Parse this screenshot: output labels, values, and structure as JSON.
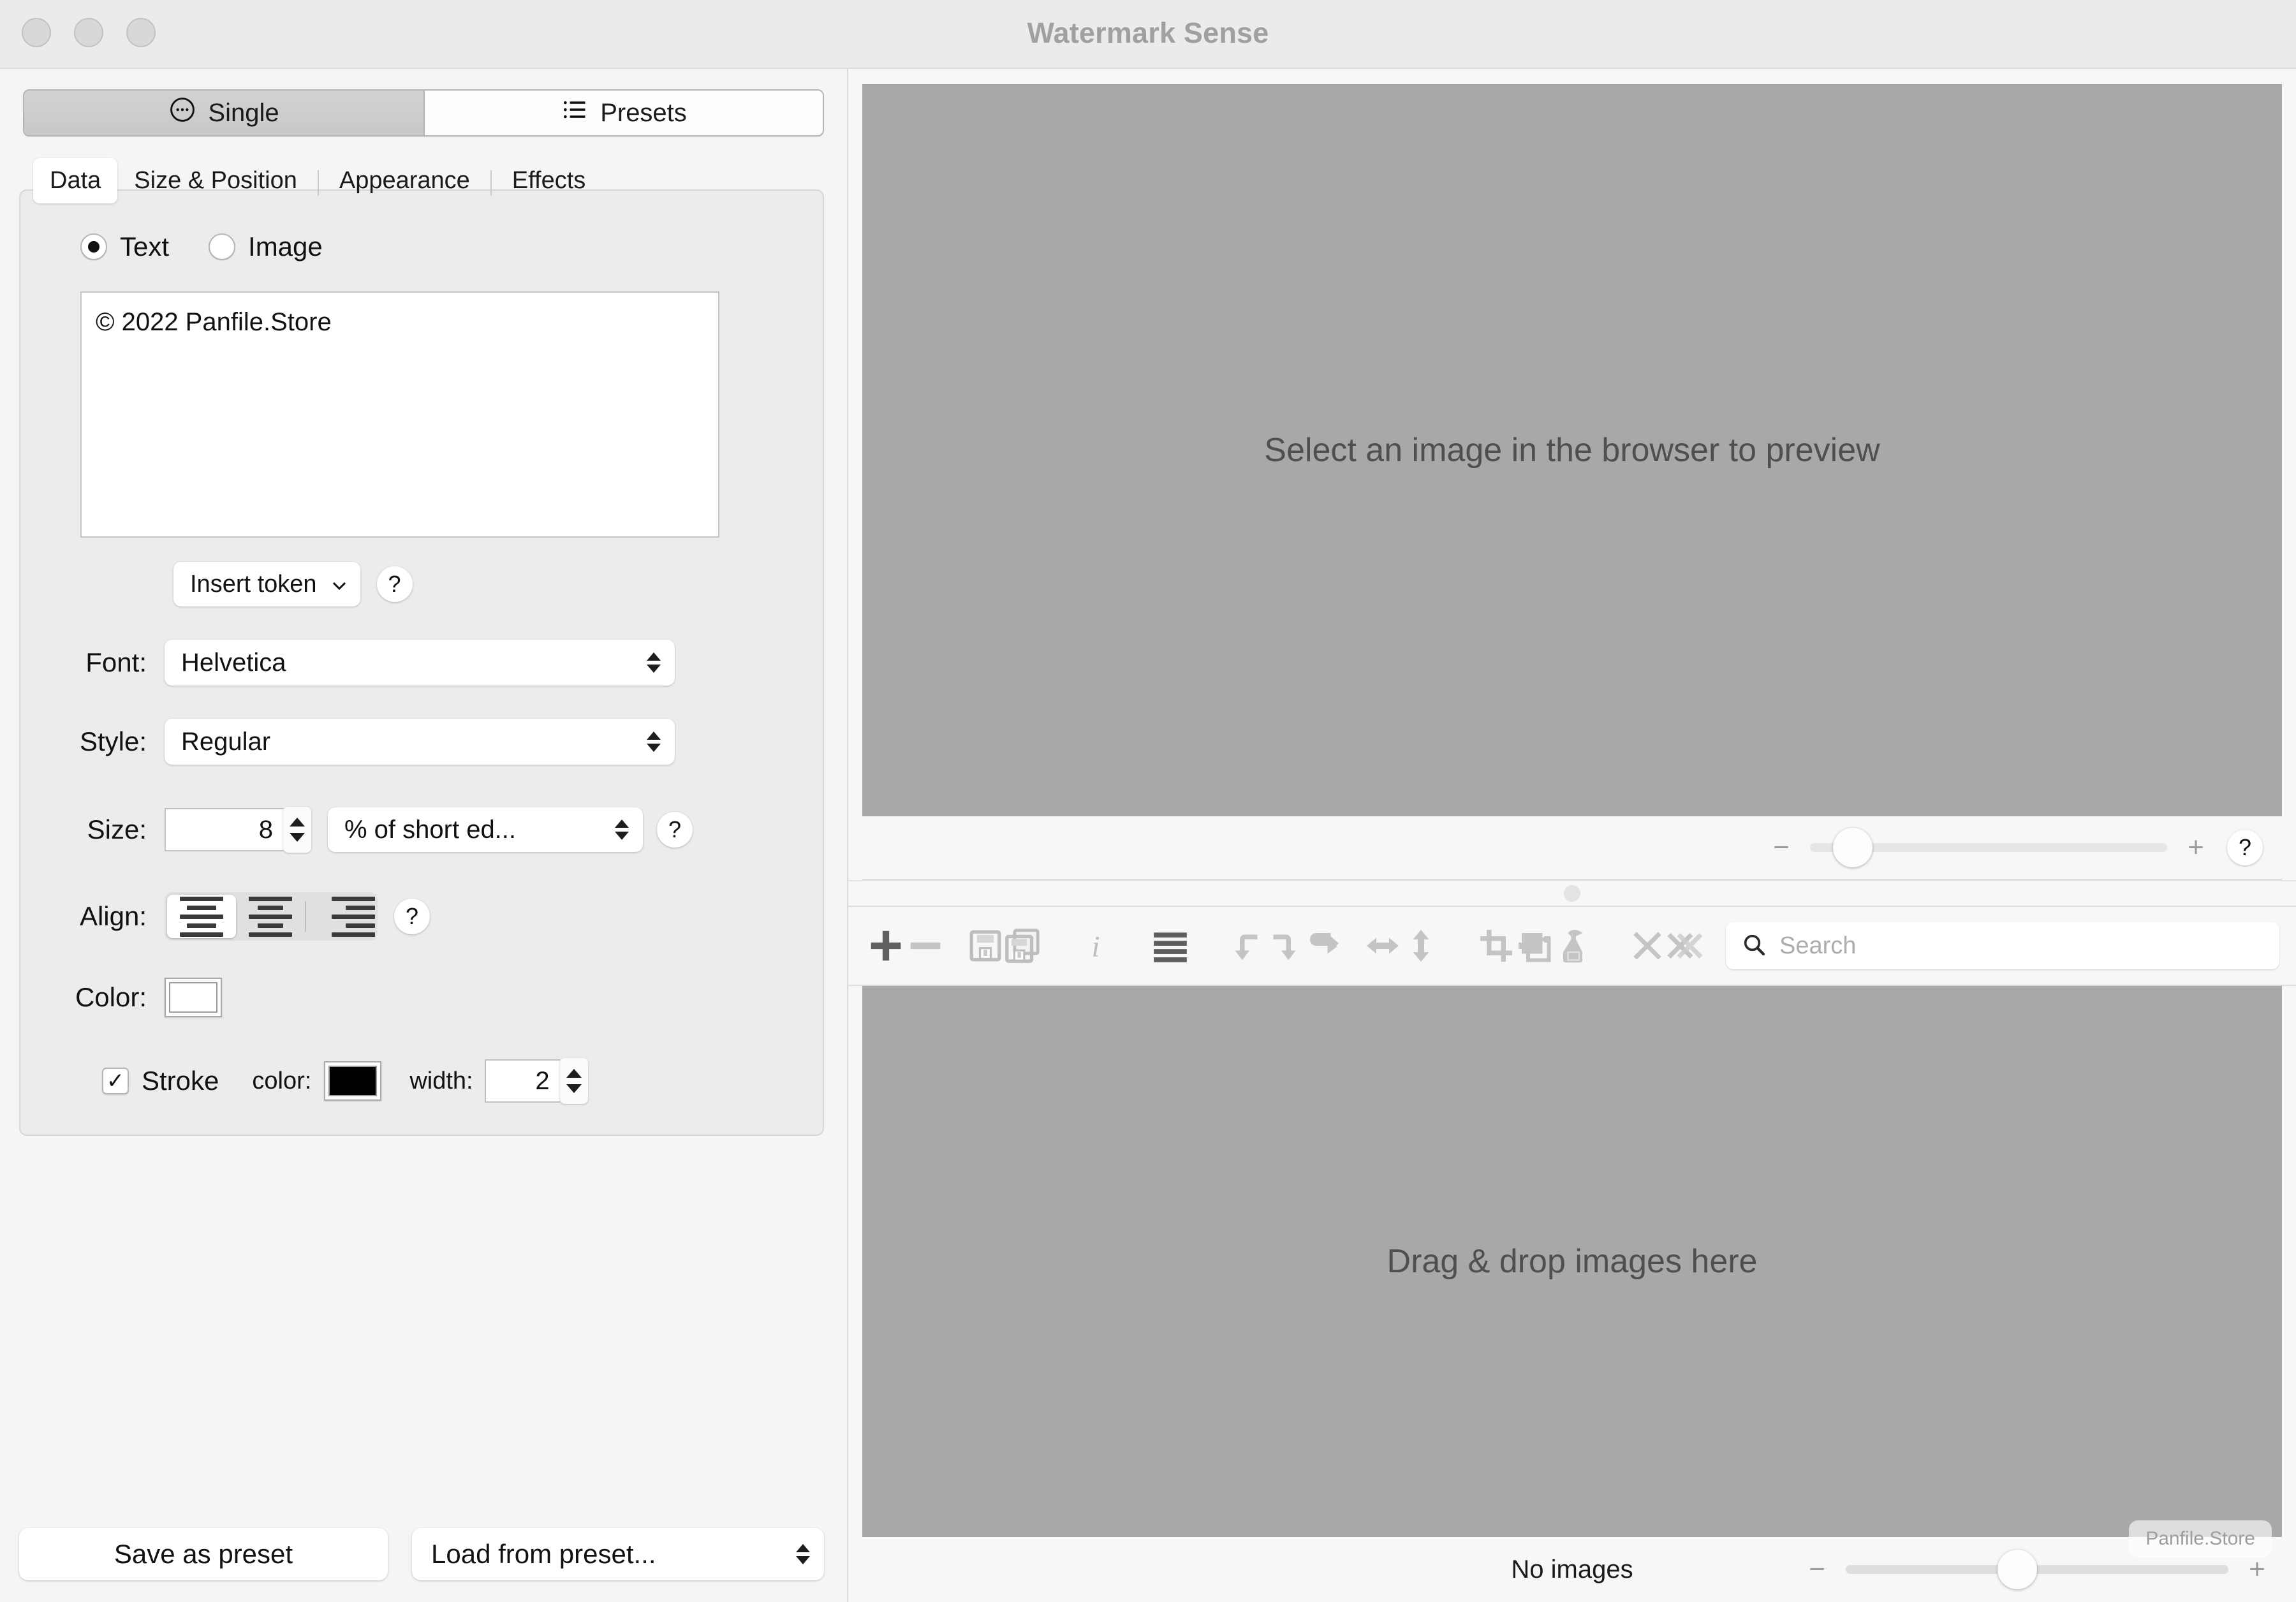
{
  "window": {
    "title": "Watermark Sense",
    "traffic_lights": [
      "close-button",
      "minimize-button",
      "zoom-button"
    ]
  },
  "mode_switch": {
    "single_label": "Single",
    "single_icon": "dots-circle-icon",
    "presets_label": "Presets",
    "presets_icon": "list-icon",
    "active": "Single"
  },
  "tabs": [
    {
      "label": "Data",
      "active": true
    },
    {
      "label": "Size & Position",
      "active": false
    },
    {
      "label": "Appearance",
      "active": false
    },
    {
      "label": "Effects",
      "active": false
    }
  ],
  "data_tab": {
    "source_type": {
      "text_label": "Text",
      "image_label": "Image",
      "selected": "Text"
    },
    "watermark_text": "© 2022 Panfile.Store",
    "insert_token_label": "Insert token",
    "insert_token_help": "?",
    "font": {
      "label": "Font:",
      "value": "Helvetica"
    },
    "style": {
      "label": "Style:",
      "value": "Regular"
    },
    "size": {
      "label": "Size:",
      "value": "8",
      "unit": "% of short ed...",
      "help": "?"
    },
    "align": {
      "label": "Align:",
      "options": [
        "align-left",
        "align-center",
        "align-right"
      ],
      "selected": "align-left",
      "help": "?"
    },
    "color": {
      "label": "Color:",
      "value": "#ffffff"
    },
    "stroke": {
      "enabled": true,
      "label": "Stroke",
      "color_label": "color:",
      "color_value": "#000000",
      "width_label": "width:",
      "width_value": "2"
    }
  },
  "presets": {
    "save_label": "Save as preset",
    "load_label": "Load from preset..."
  },
  "preview": {
    "placeholder": "Select an image in the browser to preview",
    "zoom_minus": "−",
    "zoom_plus": "+",
    "help": "?"
  },
  "toolbar": {
    "icons": [
      {
        "name": "add-icon",
        "enabled": true
      },
      {
        "name": "remove-icon",
        "enabled": false
      },
      {
        "name": "save-icon",
        "enabled": false
      },
      {
        "name": "save-copy-icon",
        "enabled": false
      },
      {
        "name": "info-icon",
        "enabled": false
      },
      {
        "name": "list-view-icon",
        "enabled": true
      },
      {
        "name": "rotate-left-icon",
        "enabled": false
      },
      {
        "name": "rotate-right-icon",
        "enabled": false
      },
      {
        "name": "rotate-180-icon",
        "enabled": false
      },
      {
        "name": "flip-horizontal-icon",
        "enabled": false
      },
      {
        "name": "flip-vertical-icon",
        "enabled": false
      },
      {
        "name": "crop-icon",
        "enabled": false
      },
      {
        "name": "transform-icon",
        "enabled": false
      },
      {
        "name": "spray-icon",
        "enabled": false
      },
      {
        "name": "remove-one-icon",
        "enabled": false
      },
      {
        "name": "remove-all-icon",
        "enabled": false
      }
    ],
    "search_placeholder": "Search",
    "search_value": "",
    "search_icon": "search-icon"
  },
  "browser": {
    "placeholder": "Drag & drop images here"
  },
  "statusbar": {
    "text": "No images",
    "zoom_minus": "−",
    "zoom_plus": "+"
  },
  "watermark_overlay": "Panfile.Store",
  "colors": {
    "window_bg": "#ececec",
    "panel_bg": "#f5f5f5",
    "image_area": "#a8a8a8",
    "text": "#111111",
    "muted_text": "#9a9a9a"
  }
}
